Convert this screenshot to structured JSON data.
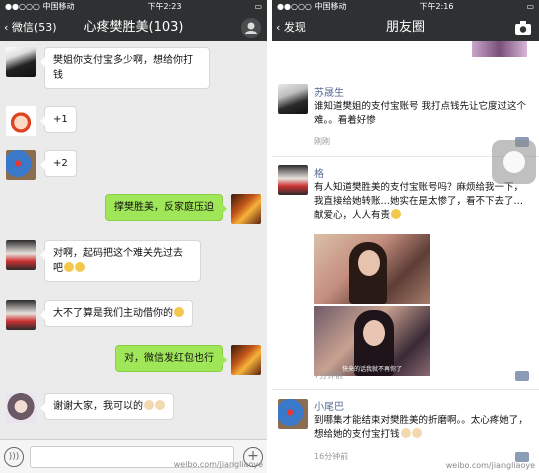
{
  "left": {
    "status": {
      "carrier": "●●○○○ 中国移动",
      "wifi": "",
      "time": "下午2:23",
      "battery": ""
    },
    "nav": {
      "back": "微信(53)",
      "title": "心疼樊胜美(103)"
    },
    "messages": [
      {
        "side": "left",
        "text": "樊姐你支付宝多少啊，想给你打钱",
        "avatar": "dark"
      },
      {
        "side": "left",
        "text": "+1",
        "avatar": "maruko"
      },
      {
        "side": "left",
        "text": "+2",
        "avatar": "doraemon"
      },
      {
        "side": "right",
        "text": "撑樊胜美，反家庭压迫",
        "avatar": "warrior"
      },
      {
        "side": "left",
        "text": "对啊，起码把这个难关先过去吧",
        "avatar": "drink"
      },
      {
        "side": "left",
        "text": "大不了算是我们主动借你的",
        "avatar": "drink"
      },
      {
        "side": "right",
        "text": "对，微信发红包也行",
        "avatar": "warrior"
      },
      {
        "side": "left",
        "text": "谢谢大家，我可以的",
        "avatar": "woman"
      }
    ],
    "watermark": "weibo.com/jiangliaoye"
  },
  "right": {
    "status": {
      "carrier": "●●○○○ 中国移动",
      "time": "下午2:16"
    },
    "nav": {
      "back": "发现",
      "title": "朋友圈"
    },
    "posts": [
      {
        "name": "苏晟生",
        "text": "谁知道樊姐的支付宝账号 我打点钱先让它度过这个难。。看着好惨",
        "time": "刚刚"
      },
      {
        "name": "格",
        "text": "有人知道樊胜美的支付宝账号吗？麻烦给我一下，我直接给她转账…她实在是太惨了，看不下去了…献爱心，人人有责",
        "time": "7分钟前",
        "caption": "快来的话我就不再你了"
      },
      {
        "name": "小尾巴",
        "text": "到哪集才能结束对樊胜美的折磨啊。。太心疼她了，想给她的支付宝打钱",
        "time": "16分钟前"
      }
    ],
    "watermark": "weibo.com/jiangliaoye"
  },
  "colors": {
    "navbar": "#2e3132",
    "me_bubble": "#9fe658",
    "name": "#576b95"
  }
}
